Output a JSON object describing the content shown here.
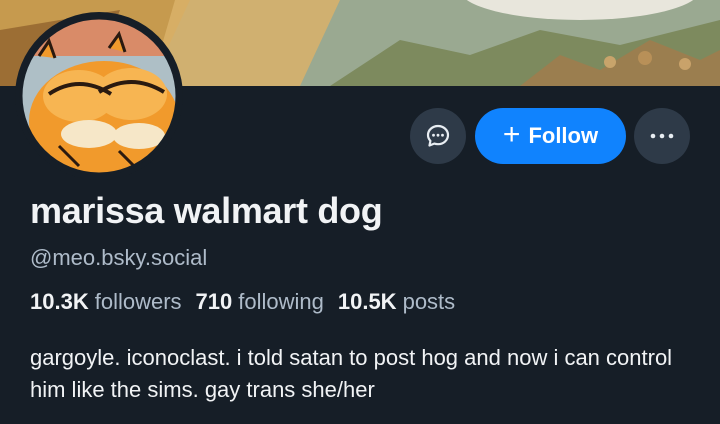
{
  "profile": {
    "display_name": "marissa walmart dog",
    "handle": "@meo.bsky.social",
    "bio": "gargoyle. iconoclast. i told satan to post hog and now i can control him like the sims. gay trans she/her"
  },
  "stats": {
    "followers_count": "10.3K",
    "followers_label": "followers",
    "following_count": "710",
    "following_label": "following",
    "posts_count": "10.5K",
    "posts_label": "posts"
  },
  "actions": {
    "follow_label": "Follow",
    "follow_icon": "plus-icon",
    "message_icon": "chat-bubble-icon",
    "more_icon": "ellipsis-icon"
  },
  "colors": {
    "background": "#161e27",
    "accent": "#1083fe",
    "button_secondary": "#2e3a48",
    "text_primary": "#f1f3f5",
    "text_secondary": "#aebbc9"
  }
}
